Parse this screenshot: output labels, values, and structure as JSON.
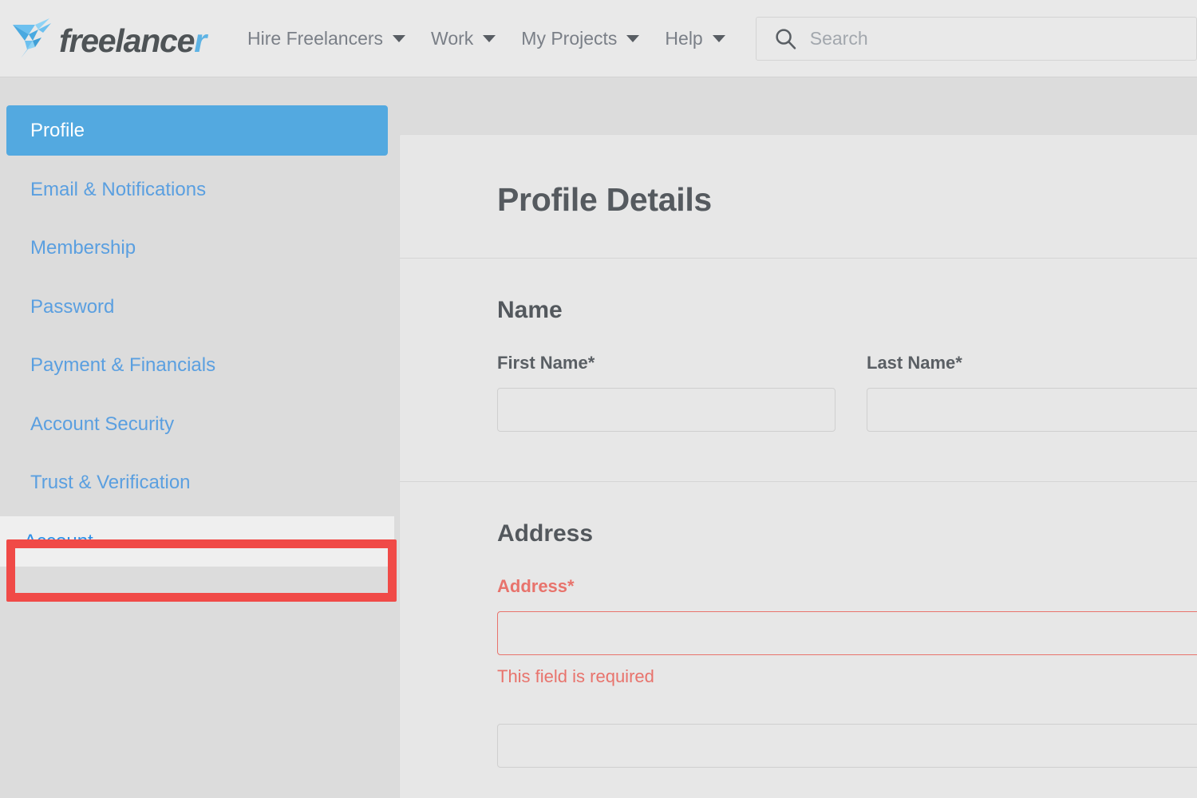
{
  "header": {
    "logo": {
      "name": "freelancer",
      "word_main": "freelance",
      "word_tail": "r",
      "icon": "freelancer-hummingbird-logo"
    },
    "nav": [
      {
        "label": "Hire Freelancers",
        "has_dropdown": true
      },
      {
        "label": "Work",
        "has_dropdown": true
      },
      {
        "label": "My Projects",
        "has_dropdown": true
      },
      {
        "label": "Help",
        "has_dropdown": true
      }
    ],
    "search": {
      "icon": "search-icon",
      "placeholder": "Search",
      "value": ""
    }
  },
  "sidebar": {
    "items": [
      {
        "label": "Profile",
        "state": "active"
      },
      {
        "label": "Email & Notifications",
        "state": "default"
      },
      {
        "label": "Membership",
        "state": "default"
      },
      {
        "label": "Password",
        "state": "default"
      },
      {
        "label": "Payment & Financials",
        "state": "default"
      },
      {
        "label": "Account Security",
        "state": "default"
      },
      {
        "label": "Trust & Verification",
        "state": "default"
      },
      {
        "label": "Account",
        "state": "hovered"
      }
    ]
  },
  "annotation": {
    "target": "Account",
    "color": "#f04a47"
  },
  "main": {
    "title": "Profile Details",
    "sections": [
      {
        "title": "Name",
        "fields": [
          {
            "label": "First Name*",
            "value": "",
            "placeholder": "",
            "error": null
          },
          {
            "label": "Last Name*",
            "value": "",
            "placeholder": "",
            "error": null
          }
        ]
      },
      {
        "title": "Address",
        "fields": [
          {
            "label": "Address*",
            "value": "",
            "placeholder": "",
            "error": "This field is required"
          },
          {
            "label": "",
            "value": "",
            "placeholder": "",
            "error": null
          }
        ]
      }
    ]
  },
  "colors": {
    "accent_blue": "#53a9e0",
    "link_blue": "#5a9fe0",
    "error_red": "#e8736c",
    "annotation_red": "#f04a47",
    "page_bg": "#dcdcdc",
    "header_bg": "#e9e9e9",
    "card_bg": "#e7e7e7"
  }
}
